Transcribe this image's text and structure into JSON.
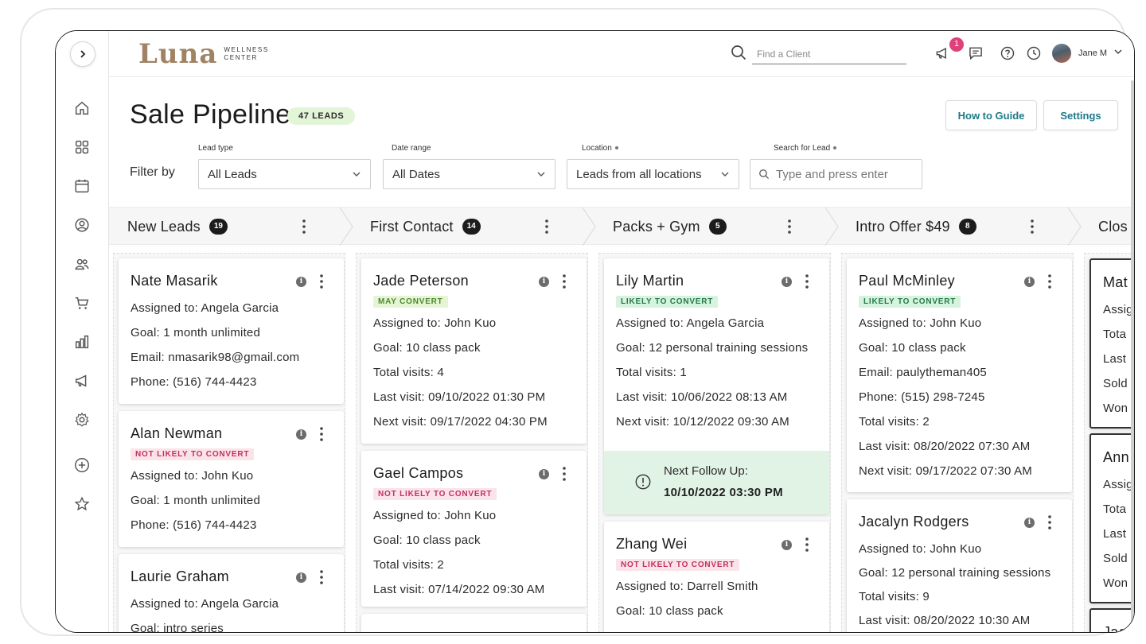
{
  "brand": {
    "name": "Luna",
    "sub_line1": "WELLNESS",
    "sub_line2": "CENTER"
  },
  "topbar": {
    "search_placeholder": "Find a Client",
    "notification_count": "1",
    "user_name": "Jane M"
  },
  "page": {
    "title": "Sale Pipeline",
    "leads_badge": "47 LEADS",
    "how_to_guide": "How to Guide",
    "settings": "Settings"
  },
  "filters": {
    "filter_by": "Filter by",
    "lead_type": {
      "label": "Lead type",
      "value": "All Leads"
    },
    "date_range": {
      "label": "Date range",
      "value": "All Dates"
    },
    "location": {
      "label": "Location",
      "value": "Leads from all locations"
    },
    "search_lead": {
      "label": "Search for Lead",
      "placeholder": "Type and press enter"
    }
  },
  "stages": [
    {
      "name": "New Leads",
      "count": "19"
    },
    {
      "name": "First Contact",
      "count": "14"
    },
    {
      "name": "Packs + Gym",
      "count": "5"
    },
    {
      "name": "Intro Offer $49",
      "count": "8"
    },
    {
      "name": "Clos",
      "count": ""
    }
  ],
  "columns": [
    {
      "cards": [
        {
          "name": "Nate Masarik",
          "tag": "",
          "lines": [
            "Assigned to: Angela Garcia",
            "Goal: 1 month unlimited",
            "Email: nmasarik98@gmail.com",
            "Phone: (516) 744-4423"
          ]
        },
        {
          "name": "Alan Newman",
          "tag": "NOT LIKELY TO CONVERT",
          "lines": [
            "Assigned to: John Kuo",
            "Goal: 1 month unlimited",
            "Phone: (516) 744-4423"
          ]
        },
        {
          "name": "Laurie Graham",
          "tag": "",
          "lines": [
            "Assigned to: Angela Garcia",
            "Goal: intro series"
          ]
        }
      ]
    },
    {
      "cards": [
        {
          "name": "Jade Peterson",
          "tag": "MAY CONVERT",
          "lines": [
            "Assigned to: John Kuo",
            "Goal: 10 class pack",
            "Total visits: 4",
            "Last visit: 09/10/2022 01:30 PM",
            "Next visit: 09/17/2022 04:30 PM"
          ]
        },
        {
          "name": "Gael Campos",
          "tag": "NOT LIKELY TO CONVERT",
          "lines": [
            "Assigned to: John Kuo",
            "Goal: 10 class pack",
            "Total visits: 2",
            "Last visit: 07/14/2022 09:30 AM"
          ]
        }
      ]
    },
    {
      "cards": [
        {
          "name": "Lily Martin",
          "tag": "LIKELY TO CONVERT",
          "lines": [
            "Assigned to: Angela Garcia",
            "Goal: 12 personal training sessions",
            "Total visits: 1",
            "Last visit: 10/06/2022 08:13 AM",
            "Next visit: 10/12/2022 09:30 AM"
          ],
          "followup_label": "Next Follow Up:",
          "followup_date": "10/10/2022 03:30 PM"
        },
        {
          "name": "Zhang Wei",
          "tag": "NOT LIKELY TO CONVERT",
          "lines": [
            "Assigned to: Darrell Smith",
            "Goal: 10 class pack"
          ]
        }
      ]
    },
    {
      "cards": [
        {
          "name": "Paul McMinley",
          "tag": "LIKELY TO CONVERT",
          "lines": [
            "Assigned to: John Kuo",
            "Goal: 10 class pack",
            "Email: paulytheman405",
            "Phone: (515) 298-7245",
            "Total visits: 2",
            "Last visit: 08/20/2022 07:30 AM",
            "Next visit: 09/17/2022 07:30 AM"
          ]
        },
        {
          "name": "Jacalyn Rodgers",
          "tag": "",
          "lines": [
            "Assigned to: John Kuo",
            "Goal: 12 personal training sessions",
            "Total visits: 9",
            "Last visit: 08/20/2022 10:30 AM"
          ]
        }
      ]
    },
    {
      "cards": [
        {
          "name": "Mat",
          "tag": "",
          "lines": [
            "Assig",
            "Tota",
            "Last",
            "Sold",
            "Won"
          ]
        },
        {
          "name": "Ann",
          "tag": "",
          "lines": [
            "Assig",
            "Tota",
            "Last",
            "Sold",
            "Won"
          ]
        },
        {
          "name": "Jac",
          "tag": "",
          "lines": []
        }
      ]
    }
  ],
  "colors": {
    "accent_teal": "#1e7a8a",
    "brand_tan": "#a08364",
    "likely_green": "#257a47",
    "not_likely_pink": "#c0315f",
    "followup_bg": "#e1f3e5",
    "badge_pink": "#e0417a"
  }
}
